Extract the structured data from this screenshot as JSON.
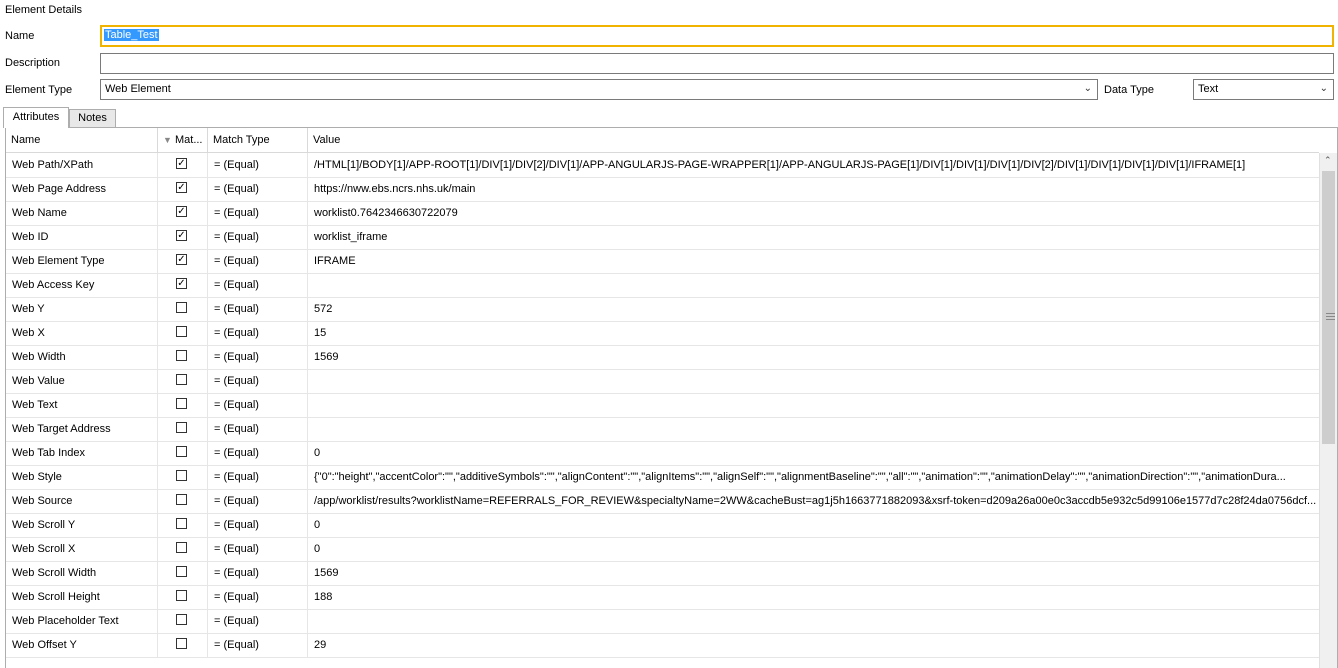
{
  "section_title": "Element Details",
  "form": {
    "name_label": "Name",
    "name_value": "Table_Test",
    "description_label": "Description",
    "description_value": "",
    "element_type_label": "Element Type",
    "element_type_value": "Web Element",
    "data_type_label": "Data Type",
    "data_type_value": "Text"
  },
  "tabs": [
    {
      "label": "Attributes",
      "active": true
    },
    {
      "label": "Notes",
      "active": false
    }
  ],
  "grid": {
    "columns": [
      "Name",
      "Mat...",
      "Match Type",
      "Value"
    ],
    "rows": [
      {
        "name": "Web Path/XPath",
        "match": true,
        "match_type": "=  (Equal)",
        "value": "/HTML[1]/BODY[1]/APP-ROOT[1]/DIV[1]/DIV[2]/DIV[1]/APP-ANGULARJS-PAGE-WRAPPER[1]/APP-ANGULARJS-PAGE[1]/DIV[1]/DIV[1]/DIV[1]/DIV[2]/DIV[1]/DIV[1]/DIV[1]/DIV[1]/IFRAME[1]"
      },
      {
        "name": "Web Page Address",
        "match": true,
        "match_type": "=  (Equal)",
        "value": "https://nww.ebs.ncrs.nhs.uk/main"
      },
      {
        "name": "Web Name",
        "match": true,
        "match_type": "=  (Equal)",
        "value": "worklist0.7642346630722079"
      },
      {
        "name": "Web ID",
        "match": true,
        "match_type": "=  (Equal)",
        "value": "worklist_iframe"
      },
      {
        "name": "Web Element Type",
        "match": true,
        "match_type": "=  (Equal)",
        "value": "IFRAME"
      },
      {
        "name": "Web Access Key",
        "match": true,
        "match_type": "=  (Equal)",
        "value": ""
      },
      {
        "name": "Web Y",
        "match": false,
        "match_type": "=  (Equal)",
        "value": "572"
      },
      {
        "name": "Web X",
        "match": false,
        "match_type": "=  (Equal)",
        "value": "15"
      },
      {
        "name": "Web Width",
        "match": false,
        "match_type": "=  (Equal)",
        "value": "1569"
      },
      {
        "name": "Web Value",
        "match": false,
        "match_type": "=  (Equal)",
        "value": ""
      },
      {
        "name": "Web Text",
        "match": false,
        "match_type": "=  (Equal)",
        "value": ""
      },
      {
        "name": "Web Target Address",
        "match": false,
        "match_type": "=  (Equal)",
        "value": ""
      },
      {
        "name": "Web Tab Index",
        "match": false,
        "match_type": "=  (Equal)",
        "value": "0"
      },
      {
        "name": "Web Style",
        "match": false,
        "match_type": "=  (Equal)",
        "value": "{\"0\":\"height\",\"accentColor\":\"\",\"additiveSymbols\":\"\",\"alignContent\":\"\",\"alignItems\":\"\",\"alignSelf\":\"\",\"alignmentBaseline\":\"\",\"all\":\"\",\"animation\":\"\",\"animationDelay\":\"\",\"animationDirection\":\"\",\"animationDura..."
      },
      {
        "name": "Web Source",
        "match": false,
        "match_type": "=  (Equal)",
        "value": "/app/worklist/results?worklistName=REFERRALS_FOR_REVIEW&specialtyName=2WW&cacheBust=ag1j5h1663771882093&xsrf-token=d209a26a00e0c3accdb5e932c5d99106e1577d7c28f24da0756dcf..."
      },
      {
        "name": "Web Scroll Y",
        "match": false,
        "match_type": "=  (Equal)",
        "value": "0"
      },
      {
        "name": "Web Scroll X",
        "match": false,
        "match_type": "=  (Equal)",
        "value": "0"
      },
      {
        "name": "Web Scroll Width",
        "match": false,
        "match_type": "=  (Equal)",
        "value": "1569"
      },
      {
        "name": "Web Scroll Height",
        "match": false,
        "match_type": "=  (Equal)",
        "value": "188"
      },
      {
        "name": "Web Placeholder Text",
        "match": false,
        "match_type": "=  (Equal)",
        "value": ""
      },
      {
        "name": "Web Offset Y",
        "match": false,
        "match_type": "=  (Equal)",
        "value": "29"
      }
    ]
  },
  "icons": {
    "filter": "filter-icon",
    "check": "checkmark-icon",
    "dropdown": "chevron-down-icon",
    "scroll_up": "scroll-up-arrow-icon"
  },
  "colors": {
    "focus_border": "#f0b400",
    "selection": "#3399ff"
  }
}
